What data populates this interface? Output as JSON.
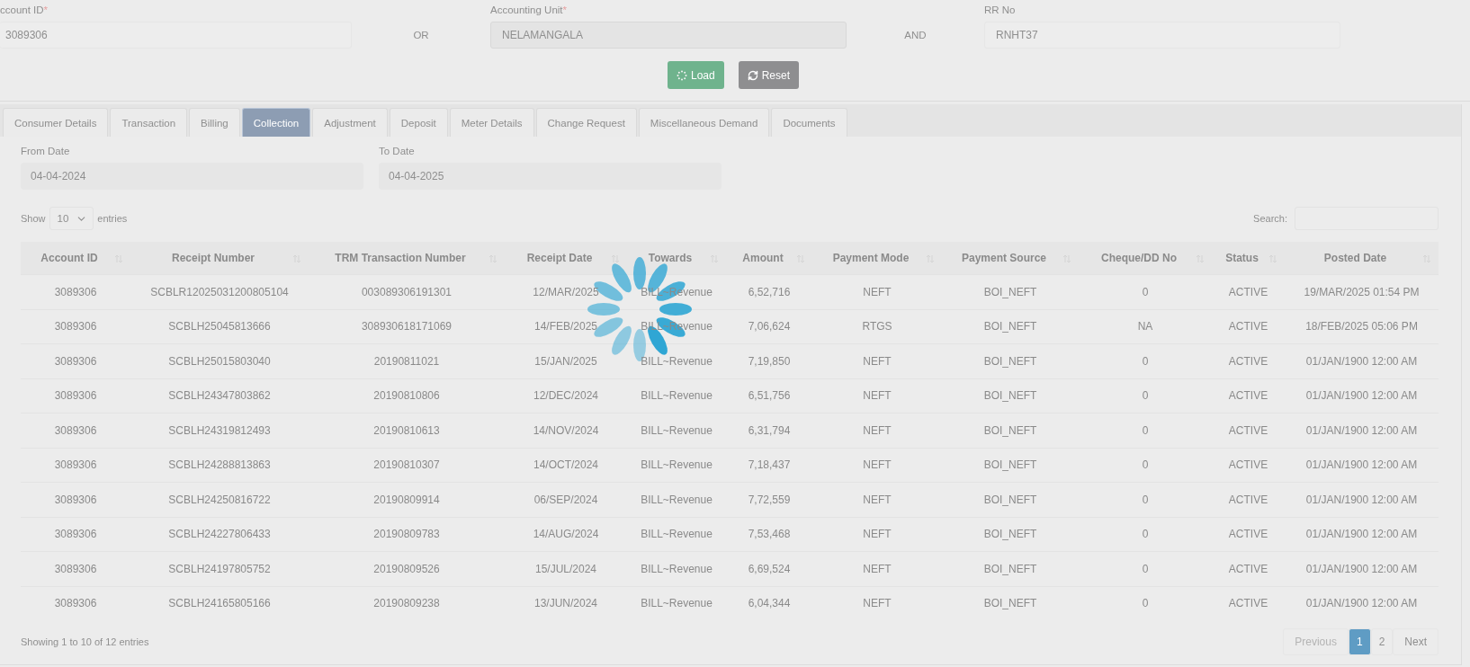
{
  "search_form": {
    "fields": [
      {
        "label": "ccount ID",
        "marker": "*",
        "value": "3089306",
        "disabled": false
      },
      {
        "label": "Accounting Unit",
        "marker": "*",
        "value": "NELAMANGALA",
        "disabled": true
      },
      {
        "label": "RR No",
        "value": "RNHT37",
        "disabled": false
      }
    ],
    "connectors": [
      "OR",
      "AND"
    ],
    "buttons": [
      {
        "kind": "load",
        "label": "Load"
      },
      {
        "kind": "reset",
        "label": "Reset"
      }
    ]
  },
  "tabs": [
    {
      "label": "Consumer Details",
      "selected": false
    },
    {
      "label": "Transaction",
      "selected": false
    },
    {
      "label": "Billing",
      "selected": false
    },
    {
      "label": "Collection",
      "selected": true
    },
    {
      "label": "Adjustment",
      "selected": false
    },
    {
      "label": "Deposit",
      "selected": false
    },
    {
      "label": "Meter Details",
      "selected": false
    },
    {
      "label": "Change Request",
      "selected": false
    },
    {
      "label": "Miscellaneous Demand",
      "selected": false
    },
    {
      "label": "Documents",
      "selected": false
    }
  ],
  "date_filters": [
    {
      "label": "From Date",
      "value": "04-04-2024"
    },
    {
      "label": "To Date",
      "value": "04-04-2025"
    }
  ],
  "length_menu": {
    "prefix": "Show",
    "value": "10",
    "suffix": "entries"
  },
  "search": {
    "label": "Search:"
  },
  "table": {
    "columns": [
      "Account ID",
      "Receipt Number",
      "TRM Transaction Number",
      "Receipt Date",
      "Towards",
      "Amount",
      "Payment Mode",
      "Payment Source",
      "Cheque/DD No",
      "Status",
      "Posted Date"
    ],
    "rows": [
      [
        "3089306",
        "SCBLR12025031200805104",
        "003089306191301",
        "12/MAR/2025",
        "BILL~Revenue",
        "6,52,716",
        "NEFT",
        "BOI_NEFT",
        "0",
        "ACTIVE",
        "19/MAR/2025 01:54 PM"
      ],
      [
        "3089306",
        "SCBLH25045813666",
        "308930618171069",
        "14/FEB/2025",
        "BILL~Revenue",
        "7,06,624",
        "RTGS",
        "BOI_NEFT",
        "NA",
        "ACTIVE",
        "18/FEB/2025 05:06 PM"
      ],
      [
        "3089306",
        "SCBLH25015803040",
        "20190811021",
        "15/JAN/2025",
        "BILL~Revenue",
        "7,19,850",
        "NEFT",
        "BOI_NEFT",
        "0",
        "ACTIVE",
        "01/JAN/1900 12:00 AM"
      ],
      [
        "3089306",
        "SCBLH24347803862",
        "20190810806",
        "12/DEC/2024",
        "BILL~Revenue",
        "6,51,756",
        "NEFT",
        "BOI_NEFT",
        "0",
        "ACTIVE",
        "01/JAN/1900 12:00 AM"
      ],
      [
        "3089306",
        "SCBLH24319812493",
        "20190810613",
        "14/NOV/2024",
        "BILL~Revenue",
        "6,31,794",
        "NEFT",
        "BOI_NEFT",
        "0",
        "ACTIVE",
        "01/JAN/1900 12:00 AM"
      ],
      [
        "3089306",
        "SCBLH24288813863",
        "20190810307",
        "14/OCT/2024",
        "BILL~Revenue",
        "7,18,437",
        "NEFT",
        "BOI_NEFT",
        "0",
        "ACTIVE",
        "01/JAN/1900 12:00 AM"
      ],
      [
        "3089306",
        "SCBLH24250816722",
        "20190809914",
        "06/SEP/2024",
        "BILL~Revenue",
        "7,72,559",
        "NEFT",
        "BOI_NEFT",
        "0",
        "ACTIVE",
        "01/JAN/1900 12:00 AM"
      ],
      [
        "3089306",
        "SCBLH24227806433",
        "20190809783",
        "14/AUG/2024",
        "BILL~Revenue",
        "7,53,468",
        "NEFT",
        "BOI_NEFT",
        "0",
        "ACTIVE",
        "01/JAN/1900 12:00 AM"
      ],
      [
        "3089306",
        "SCBLH24197805752",
        "20190809526",
        "15/JUL/2024",
        "BILL~Revenue",
        "6,69,524",
        "NEFT",
        "BOI_NEFT",
        "0",
        "ACTIVE",
        "01/JAN/1900 12:00 AM"
      ],
      [
        "3089306",
        "SCBLH24165805166",
        "20190809238",
        "13/JUN/2024",
        "BILL~Revenue",
        "6,04,344",
        "NEFT",
        "BOI_NEFT",
        "0",
        "ACTIVE",
        "01/JAN/1900 12:00 AM"
      ]
    ]
  },
  "table_info": "Showing 1 to 10 of 12 entries",
  "pagination": [
    {
      "kind": "nav",
      "label": "Previous",
      "disabled": true,
      "selected": false
    },
    {
      "kind": "page",
      "label": "1",
      "selected": true
    },
    {
      "kind": "page",
      "label": "2",
      "selected": false
    },
    {
      "kind": "nav",
      "label": "Next",
      "disabled": false,
      "selected": false
    }
  ],
  "loading": true
}
